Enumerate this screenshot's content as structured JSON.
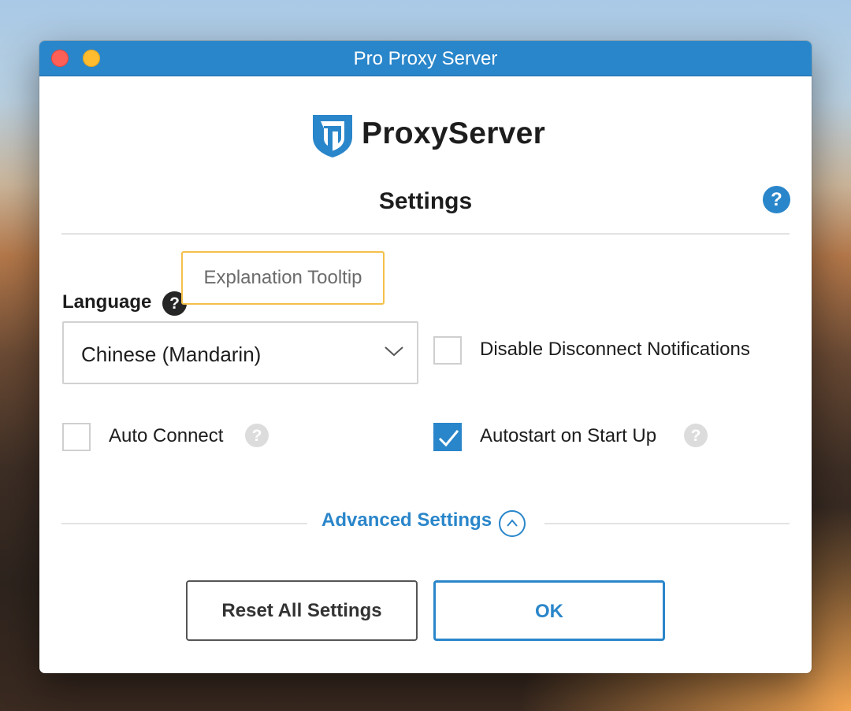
{
  "window": {
    "title": "Pro Proxy Server"
  },
  "brand": {
    "name": "ProxyServer",
    "color": "#2a86ca"
  },
  "settings": {
    "heading": "Settings",
    "help_symbol": "?"
  },
  "tooltip": {
    "text": "Explanation Tooltip"
  },
  "language": {
    "label": "Language",
    "help_symbol": "?",
    "selected": "Chinese (Mandarin)"
  },
  "options": {
    "disable_disconnect_notifications": {
      "label": "Disable Disconnect Notifications",
      "checked": false
    },
    "auto_connect": {
      "label": "Auto Connect",
      "checked": false,
      "help_symbol": "?"
    },
    "autostart": {
      "label": "Autostart on Start Up",
      "checked": true,
      "help_symbol": "?"
    }
  },
  "advanced": {
    "label": "Advanced Settings",
    "icon": "chevron-up-icon"
  },
  "buttons": {
    "reset": "Reset All Settings",
    "ok": "OK"
  },
  "colors": {
    "accent": "#2a86ca",
    "tooltip_border": "#f5c04a",
    "close": "#fe5f57",
    "minimize": "#febc2e"
  }
}
